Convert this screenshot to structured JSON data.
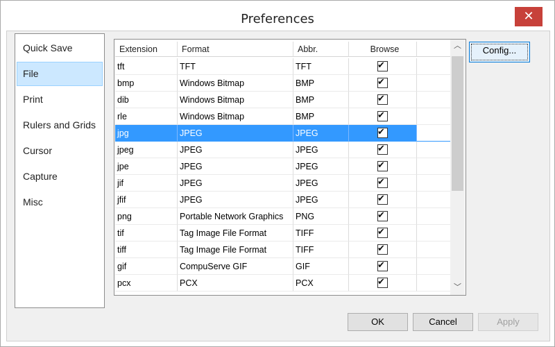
{
  "window": {
    "title": "Preferences",
    "close_icon": "close-icon"
  },
  "sidebar": {
    "items": [
      {
        "label": "Quick Save"
      },
      {
        "label": "File"
      },
      {
        "label": "Print"
      },
      {
        "label": "Rulers and Grids"
      },
      {
        "label": "Cursor"
      },
      {
        "label": "Capture"
      },
      {
        "label": "Misc"
      }
    ],
    "selected": "File"
  },
  "table": {
    "headers": [
      "Extension",
      "Format",
      "Abbr.",
      "Browse"
    ],
    "rows": [
      {
        "ext": "tft",
        "format": "TFT",
        "abbr": "TFT",
        "browse": true
      },
      {
        "ext": "bmp",
        "format": "Windows Bitmap",
        "abbr": "BMP",
        "browse": true
      },
      {
        "ext": "dib",
        "format": "Windows Bitmap",
        "abbr": "BMP",
        "browse": true
      },
      {
        "ext": "rle",
        "format": "Windows Bitmap",
        "abbr": "BMP",
        "browse": true
      },
      {
        "ext": "jpg",
        "format": "JPEG",
        "abbr": "JPEG",
        "browse": true
      },
      {
        "ext": "jpeg",
        "format": "JPEG",
        "abbr": "JPEG",
        "browse": true
      },
      {
        "ext": "jpe",
        "format": "JPEG",
        "abbr": "JPEG",
        "browse": true
      },
      {
        "ext": "jif",
        "format": "JPEG",
        "abbr": "JPEG",
        "browse": true
      },
      {
        "ext": "jfif",
        "format": "JPEG",
        "abbr": "JPEG",
        "browse": true
      },
      {
        "ext": "png",
        "format": "Portable Network Graphics",
        "abbr": "PNG",
        "browse": true
      },
      {
        "ext": "tif",
        "format": "Tag Image File Format",
        "abbr": "TIFF",
        "browse": true
      },
      {
        "ext": "tiff",
        "format": "Tag Image File Format",
        "abbr": "TIFF",
        "browse": true
      },
      {
        "ext": "gif",
        "format": "CompuServe GIF",
        "abbr": "GIF",
        "browse": true
      },
      {
        "ext": "pcx",
        "format": "PCX",
        "abbr": "PCX",
        "browse": true
      }
    ],
    "selected_ext": "jpg"
  },
  "buttons": {
    "config": "Config...",
    "ok": "OK",
    "cancel": "Cancel",
    "apply": "Apply"
  },
  "colors": {
    "selection": "#3399ff",
    "sidebar_selection": "#cce8ff",
    "close_button": "#c7413a"
  }
}
